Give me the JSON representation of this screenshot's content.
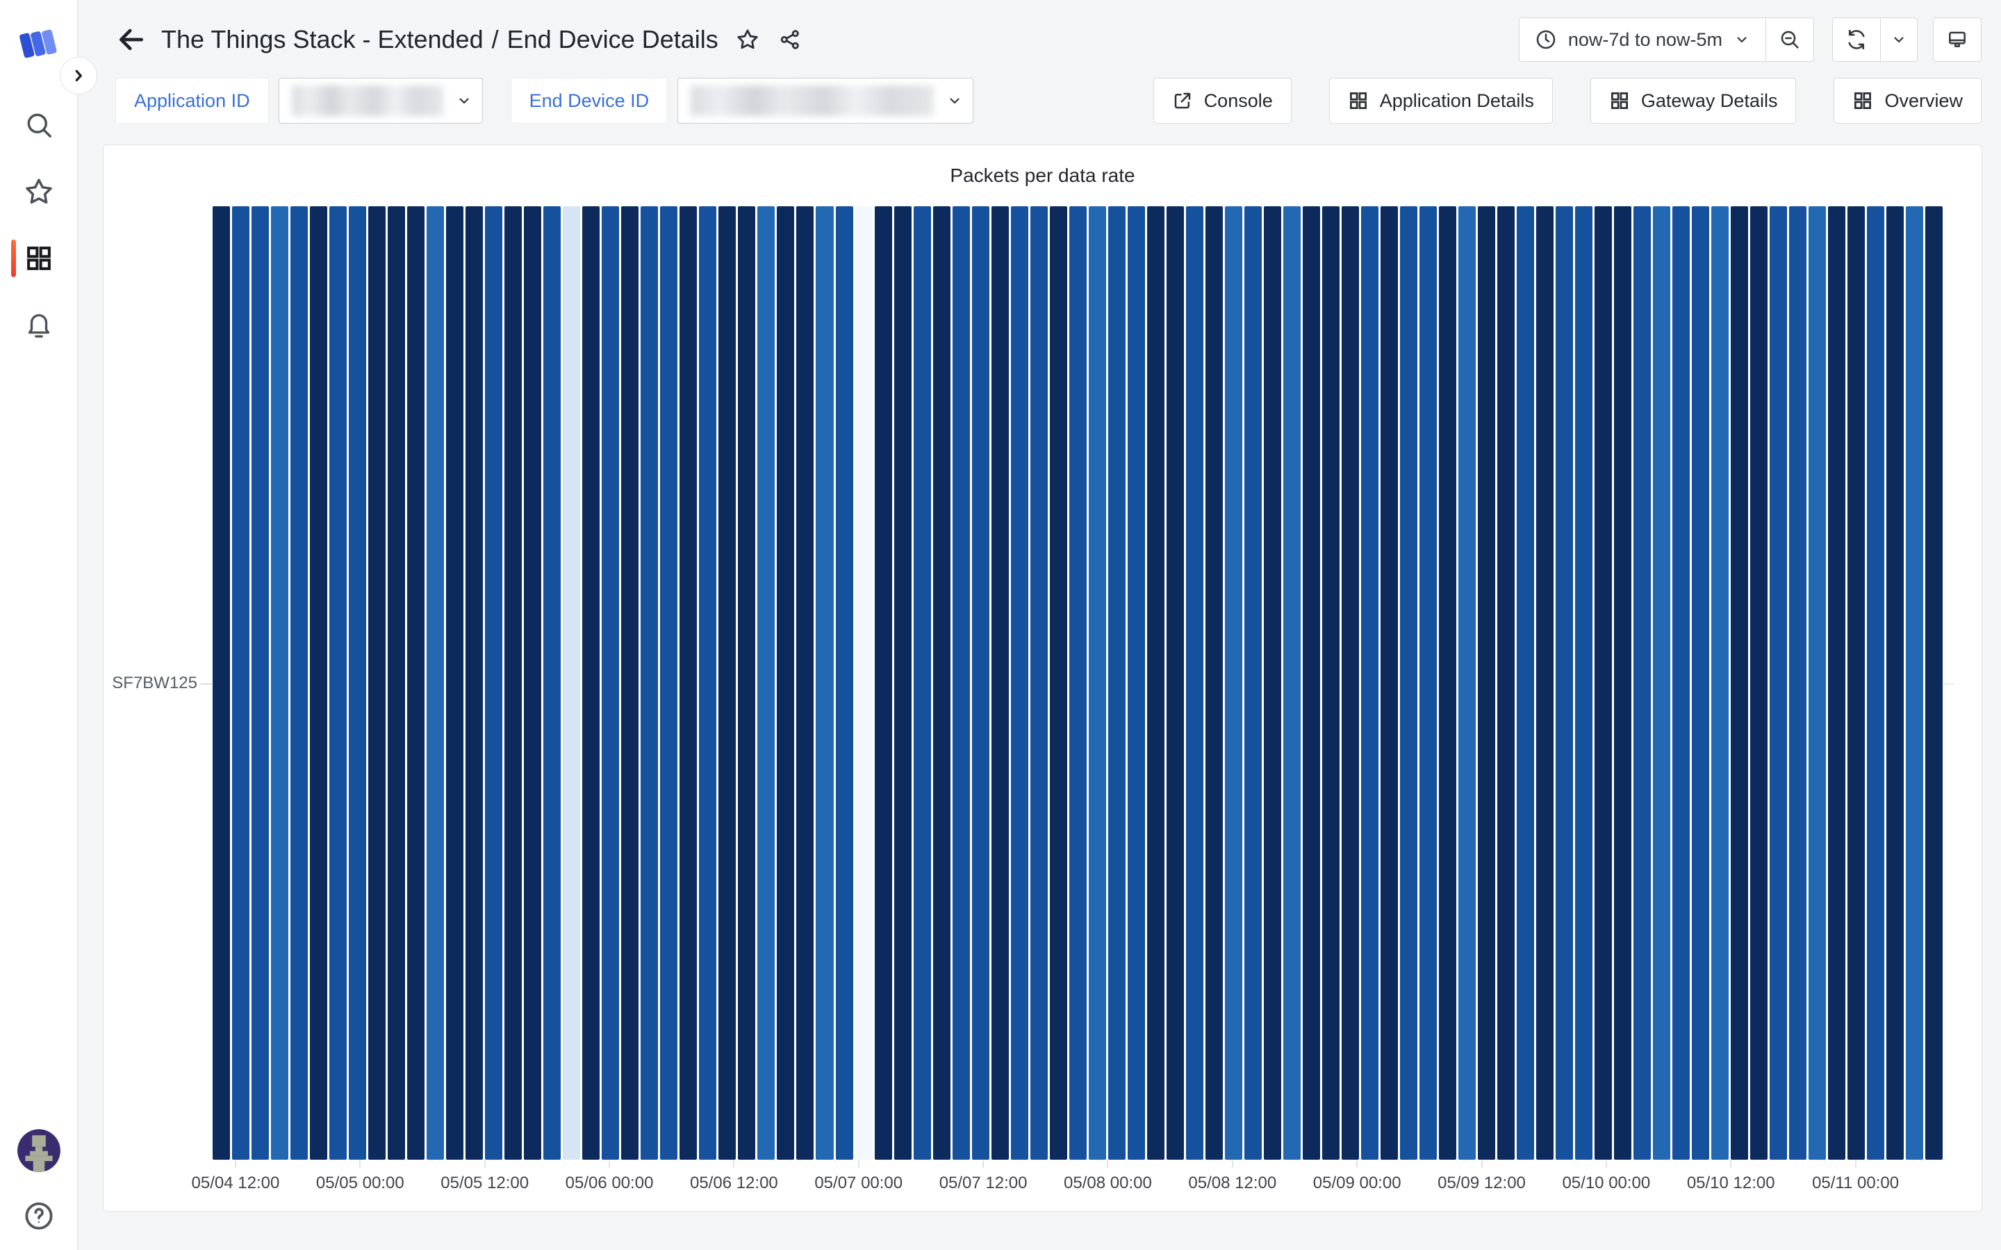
{
  "header": {
    "dashboard_folder": "The Things Stack - Extended",
    "separator": "/",
    "dashboard_name": "End Device Details",
    "time_range": "now-7d to now-5m"
  },
  "sidebar": {
    "items": [
      {
        "name": "search"
      },
      {
        "name": "starred"
      },
      {
        "name": "dashboards",
        "active": true
      },
      {
        "name": "alerting"
      }
    ],
    "bottom": [
      {
        "name": "profile-avatar"
      },
      {
        "name": "help"
      }
    ]
  },
  "variables": {
    "application_id": {
      "label": "Application ID",
      "value_redacted": true
    },
    "end_device_id": {
      "label": "End Device ID",
      "value_redacted": true
    }
  },
  "links": [
    {
      "label": "Console",
      "icon": "external-link-icon"
    },
    {
      "label": "Application Details",
      "icon": "apps-icon"
    },
    {
      "label": "Gateway Details",
      "icon": "apps-icon"
    },
    {
      "label": "Overview",
      "icon": "apps-icon"
    }
  ],
  "panel": {
    "title": "Packets per data rate"
  },
  "chart_data": {
    "type": "heatmap",
    "title": "Packets per data rate",
    "y_categories": [
      "SF7BW125"
    ],
    "x_ticks": [
      "05/04 12:00",
      "05/05 00:00",
      "05/05 12:00",
      "05/06 00:00",
      "05/06 12:00",
      "05/07 00:00",
      "05/07 12:00",
      "05/08 00:00",
      "05/08 12:00",
      "05/09 00:00",
      "05/09 12:00",
      "05/10 00:00",
      "05/10 12:00",
      "05/11 00:00"
    ],
    "legend": "none",
    "grid": false,
    "palette": {
      "0": "#f3f8fe",
      "1": "#d7e4f4",
      "2": "#2268b2",
      "3": "#16519d",
      "5": "#0c2a5b"
    },
    "palette_meaning": "lighter = fewer packets, darker navy = more packets",
    "color_levels": [
      5,
      3,
      3,
      2,
      3,
      5,
      3,
      3,
      5,
      5,
      5,
      2,
      5,
      5,
      3,
      5,
      5,
      3,
      1,
      5,
      3,
      5,
      3,
      3,
      5,
      3,
      5,
      5,
      2,
      5,
      5,
      2,
      3,
      0,
      5,
      5,
      3,
      5,
      3,
      3,
      5,
      3,
      3,
      5,
      3,
      2,
      3,
      3,
      5,
      5,
      3,
      5,
      2,
      3,
      5,
      2,
      5,
      5,
      5,
      3,
      5,
      3,
      3,
      5,
      2,
      5,
      5,
      3,
      5,
      3,
      3,
      5,
      5,
      3,
      2,
      3,
      3,
      2,
      5,
      5,
      3,
      3,
      2,
      5,
      5,
      3,
      5,
      2,
      5
    ],
    "layout": {
      "first_tick_frac": 0.01324,
      "tick_step_frac": 0.07203
    }
  }
}
